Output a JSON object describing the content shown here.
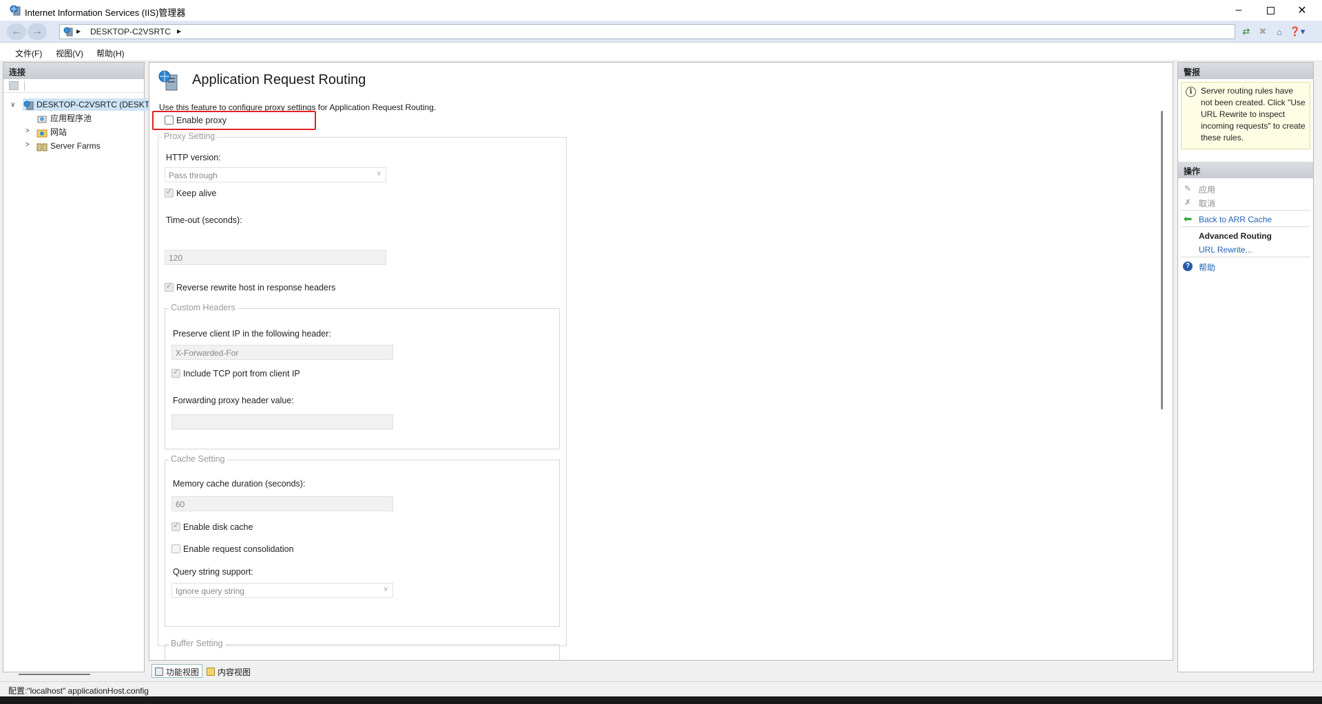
{
  "window": {
    "title": "Internet Information Services (IIS)管理器"
  },
  "address": {
    "segments": [
      "DESKTOP-C2VSRTC"
    ]
  },
  "menu": {
    "items": [
      "文件(F)",
      "视图(V)",
      "帮助(H)"
    ]
  },
  "connections": {
    "header": "连接",
    "tree": {
      "server": "DESKTOP-C2VSRTC (DESKT",
      "children": [
        "应用程序池",
        "网站",
        "Server Farms"
      ]
    }
  },
  "feature": {
    "title": "Application Request Routing",
    "description": "Use this feature to configure proxy settings for Application Request Routing.",
    "enable_proxy": "Enable proxy",
    "proxy_setting": {
      "legend": "Proxy Setting",
      "http_version_label": "HTTP version:",
      "http_version_value": "Pass through",
      "keep_alive": "Keep alive",
      "timeout_label": "Time-out (seconds):",
      "timeout_value": "120",
      "reverse_rewrite": "Reverse rewrite host in response headers"
    },
    "custom_headers": {
      "legend": "Custom Headers",
      "preserve_ip_label": "Preserve client IP in the following header:",
      "preserve_ip_value": "X-Forwarded-For",
      "include_tcp_port": "Include TCP port from client IP",
      "forwarding_label": "Forwarding proxy header value:",
      "forwarding_value": ""
    },
    "cache_setting": {
      "legend": "Cache Setting",
      "memory_label": "Memory cache duration (seconds):",
      "memory_value": "60",
      "disk_cache": "Enable disk cache",
      "request_consolidation": "Enable request consolidation",
      "query_label": "Query string support:",
      "query_value": "Ignore query string"
    },
    "buffer_setting": {
      "legend": "Buffer Setting"
    }
  },
  "view_tabs": [
    "功能视图",
    "内容视图"
  ],
  "alerts": {
    "header": "警报",
    "message": "Server routing rules have not been created. Click \"Use URL Rewrite to inspect incoming requests\" to create these rules."
  },
  "actions": {
    "header": "操作",
    "apply": "应用",
    "cancel": "取消",
    "back": "Back to ARR Cache",
    "advanced_heading": "Advanced Routing",
    "url_rewrite": "URL Rewrite...",
    "help": "帮助"
  },
  "status": {
    "text": "配置:\"localhost\" applicationHost.config"
  },
  "colors": {
    "link": "#1f63b5",
    "highlight_box": "#e02020",
    "disabled_text": "#8a8a8a"
  }
}
